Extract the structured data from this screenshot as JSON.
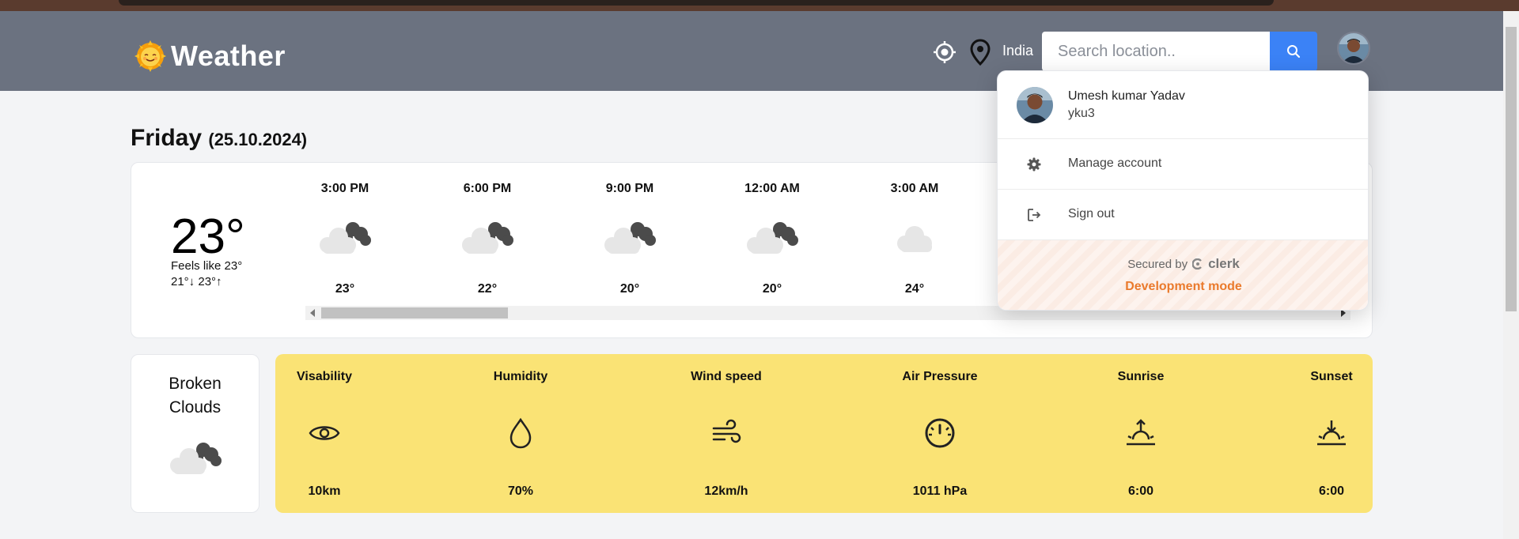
{
  "header": {
    "app_title": "Weather",
    "country": "India",
    "search_placeholder": "Search location.."
  },
  "day": {
    "name": "Friday",
    "date": "(25.10.2024)"
  },
  "current": {
    "temp": "23°",
    "feels_like": "Feels like 23°",
    "min_max": "21°↓  23°↑",
    "condition_line1": "Broken",
    "condition_line2": "Clouds"
  },
  "hourly": [
    {
      "time": "3:00 PM",
      "temp": "23°",
      "icon": "broken-clouds-icon"
    },
    {
      "time": "6:00 PM",
      "temp": "22°",
      "icon": "broken-clouds-icon"
    },
    {
      "time": "9:00 PM",
      "temp": "20°",
      "icon": "broken-clouds-icon"
    },
    {
      "time": "12:00 AM",
      "temp": "20°",
      "icon": "broken-clouds-icon"
    },
    {
      "time": "3:00 AM",
      "temp": "24°",
      "icon": "cloud-icon"
    }
  ],
  "stats": [
    {
      "label": "Visability",
      "value": "10km",
      "icon": "eye-icon"
    },
    {
      "label": "Humidity",
      "value": "70%",
      "icon": "droplet-icon"
    },
    {
      "label": "Wind speed",
      "value": "12km/h",
      "icon": "wind-icon"
    },
    {
      "label": "Air Pressure",
      "value": "1011 hPa",
      "icon": "gauge-icon"
    },
    {
      "label": "Sunrise",
      "value": "6:00",
      "icon": "sunrise-icon"
    },
    {
      "label": "Sunset",
      "value": "6:00",
      "icon": "sunset-icon"
    }
  ],
  "user_menu": {
    "name": "Umesh kumar Yadav",
    "username": "yku3",
    "manage_label": "Manage account",
    "signout_label": "Sign out",
    "secured_by": "Secured by",
    "brand": "clerk",
    "dev_mode": "Development mode"
  },
  "colors": {
    "header_bg": "#6b7280",
    "search_button": "#3b82f6",
    "stats_bg": "#fae375",
    "dev_mode": "#ea7a2c"
  }
}
